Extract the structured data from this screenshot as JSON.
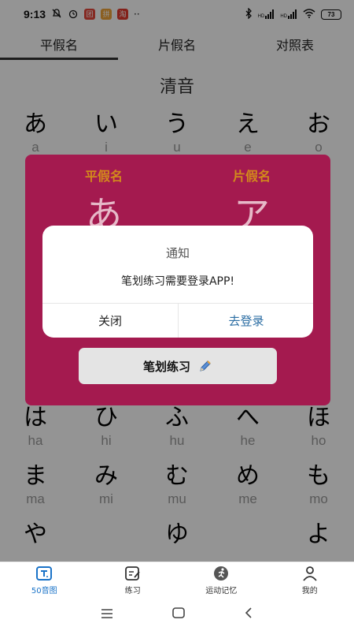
{
  "status": {
    "time": "9:13",
    "badge1": "团",
    "badge2": "拼",
    "badge3": "淘",
    "more": "··",
    "signal1": "HD",
    "signal2": "HD",
    "battery": "73"
  },
  "tabs": [
    {
      "label": "平假名",
      "active": true
    },
    {
      "label": "片假名",
      "active": false
    },
    {
      "label": "对照表",
      "active": false
    }
  ],
  "section_title": "清音",
  "kana_rows": [
    [
      {
        "kana": "あ",
        "romaji": "a"
      },
      {
        "kana": "い",
        "romaji": "i"
      },
      {
        "kana": "う",
        "romaji": "u"
      },
      {
        "kana": "え",
        "romaji": "e"
      },
      {
        "kana": "お",
        "romaji": "o"
      }
    ],
    [
      {
        "kana": "は",
        "romaji": "ha"
      },
      {
        "kana": "ひ",
        "romaji": "hi"
      },
      {
        "kana": "ふ",
        "romaji": "hu"
      },
      {
        "kana": "へ",
        "romaji": "he"
      },
      {
        "kana": "ほ",
        "romaji": "ho"
      }
    ],
    [
      {
        "kana": "ま",
        "romaji": "ma"
      },
      {
        "kana": "み",
        "romaji": "mi"
      },
      {
        "kana": "む",
        "romaji": "mu"
      },
      {
        "kana": "め",
        "romaji": "me"
      },
      {
        "kana": "も",
        "romaji": "mo"
      }
    ],
    [
      {
        "kana": "や",
        "romaji": ""
      },
      {
        "kana": "",
        "romaji": ""
      },
      {
        "kana": "ゆ",
        "romaji": ""
      },
      {
        "kana": "",
        "romaji": ""
      },
      {
        "kana": "よ",
        "romaji": ""
      }
    ]
  ],
  "card": {
    "hiragana_label": "平假名",
    "katakana_label": "片假名",
    "hiragana": "あ",
    "katakana": "ア",
    "stroke_button": "笔划练习",
    "color": "#a41a4f"
  },
  "dialog": {
    "title": "通知",
    "message": "笔划练习需要登录APP!",
    "close_label": "关闭",
    "login_label": "去登录",
    "login_color": "#2b6da3"
  },
  "bottom_nav": [
    {
      "label": "50音图",
      "icon": "chart-50-icon",
      "active": true
    },
    {
      "label": "练习",
      "icon": "practice-icon",
      "active": false
    },
    {
      "label": "运动记忆",
      "icon": "motion-memory-icon",
      "active": false
    },
    {
      "label": "我的",
      "icon": "profile-icon",
      "active": false
    }
  ],
  "accent_color": "#1a73c8"
}
